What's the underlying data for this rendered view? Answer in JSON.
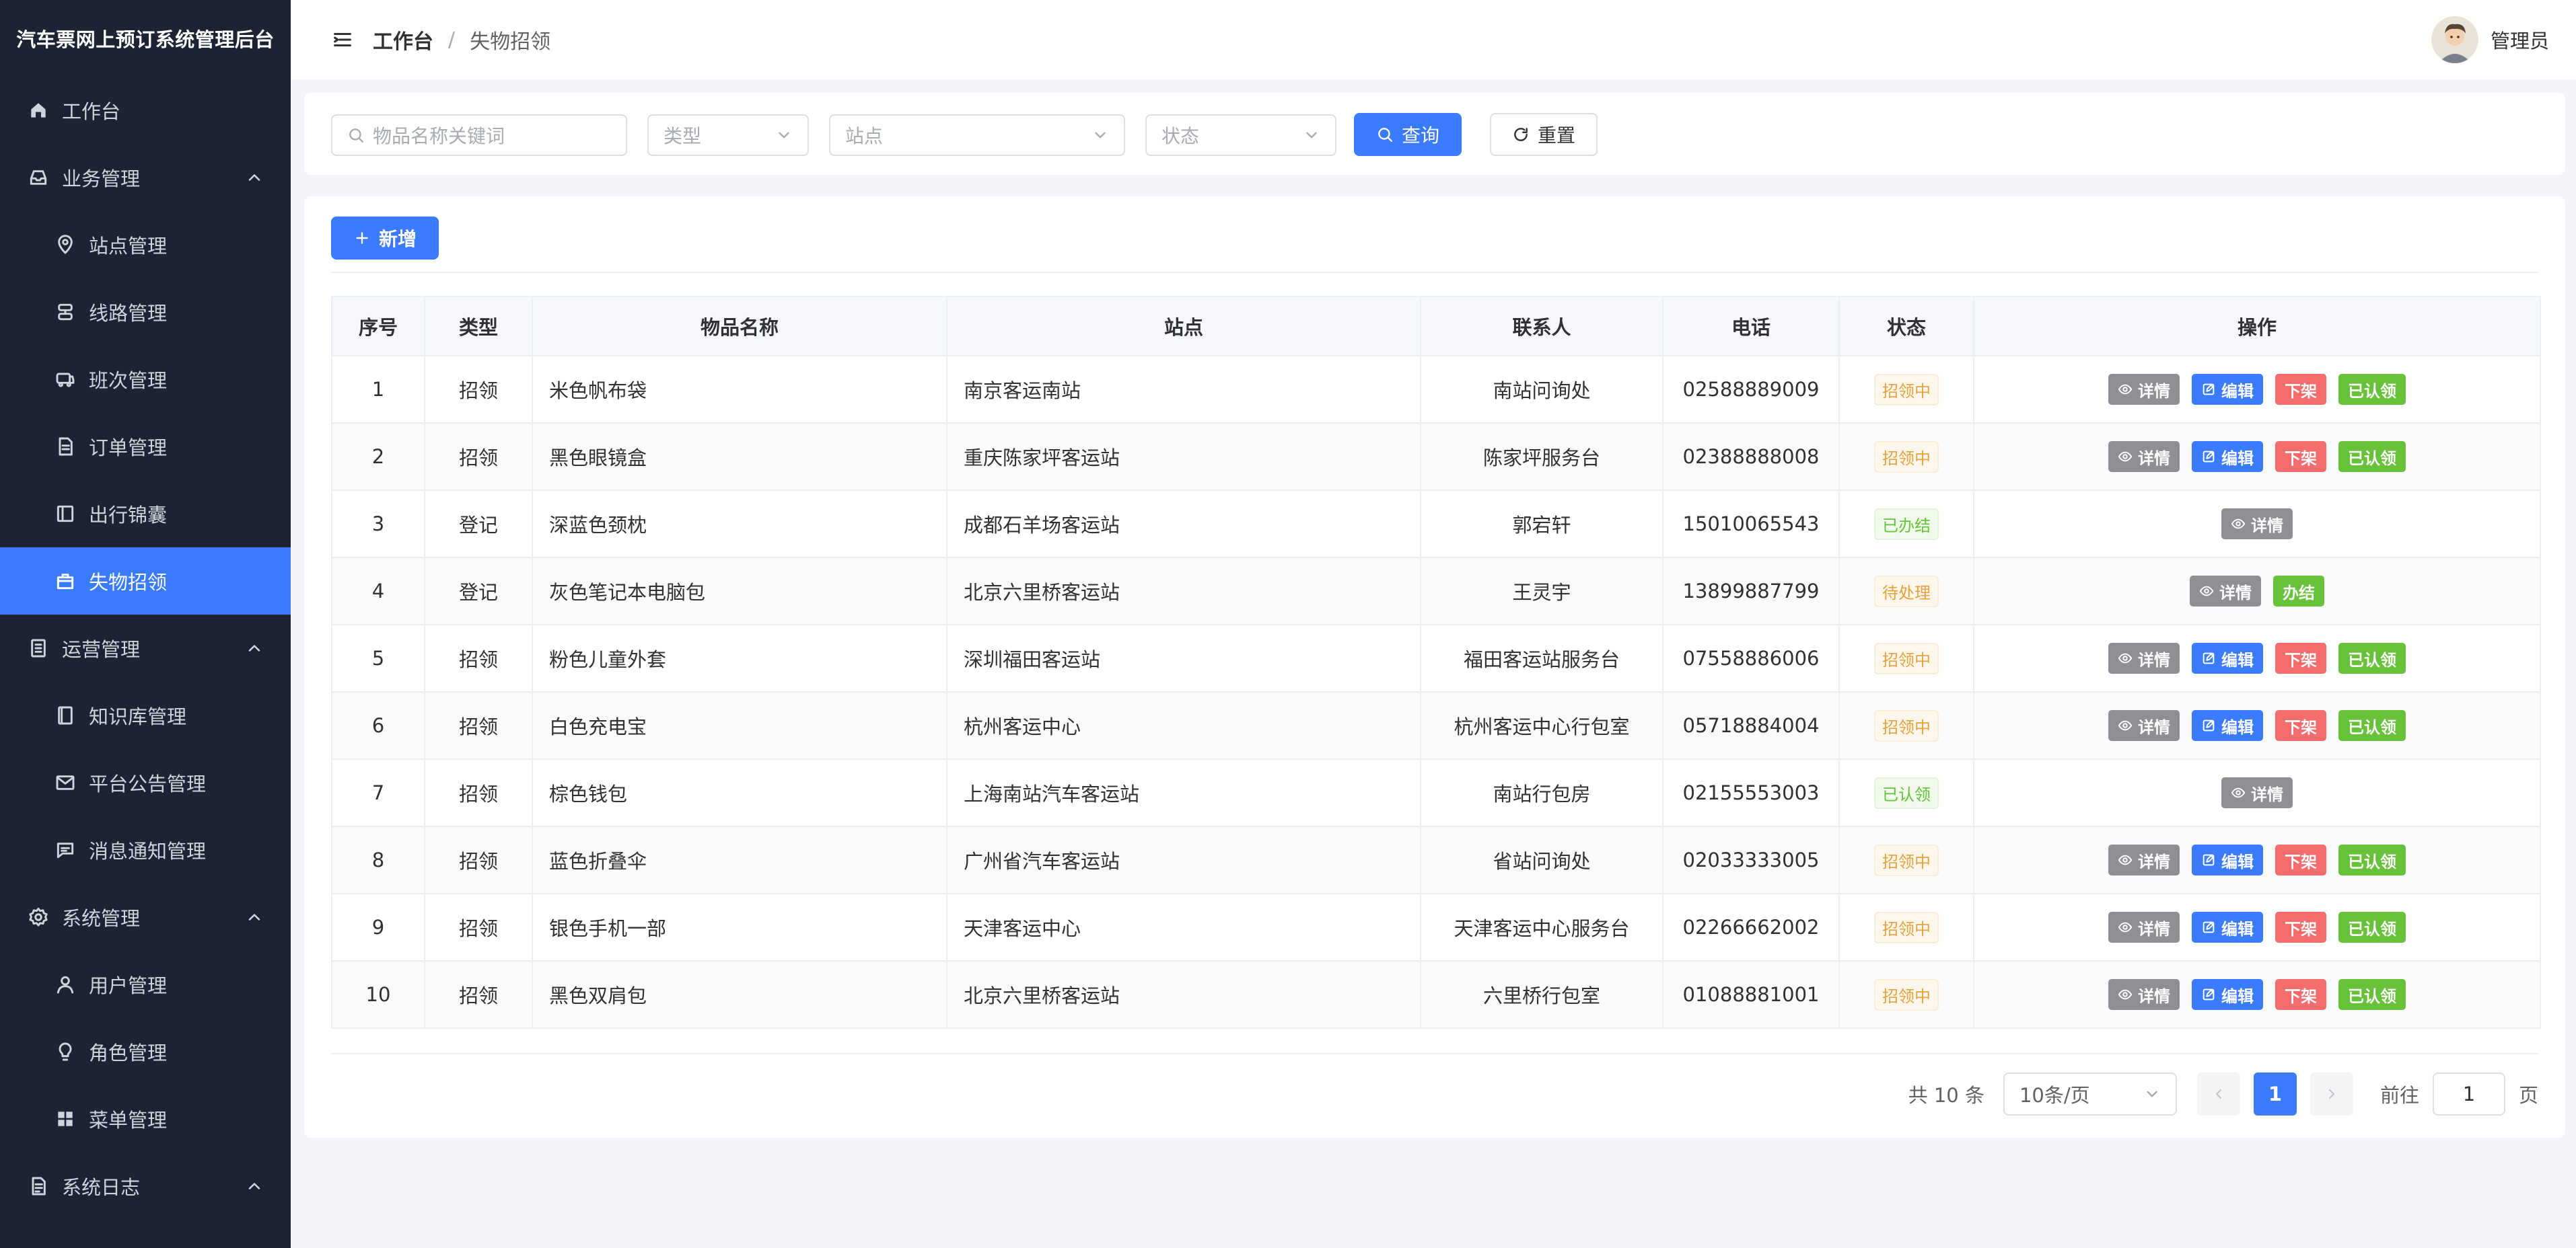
{
  "app": {
    "title": "汽车票网上预订系统管理后台"
  },
  "sidebar": {
    "items": [
      {
        "label": "工作台",
        "icon": "home-icon",
        "level": 0
      },
      {
        "label": "业务管理",
        "icon": "inbox-icon",
        "level": 0,
        "expanded": true
      },
      {
        "label": "站点管理",
        "icon": "location-icon",
        "level": 1
      },
      {
        "label": "线路管理",
        "icon": "route-icon",
        "level": 1
      },
      {
        "label": "班次管理",
        "icon": "bus-icon",
        "level": 1
      },
      {
        "label": "订单管理",
        "icon": "document-icon",
        "level": 1
      },
      {
        "label": "出行锦囊",
        "icon": "notebook-icon",
        "level": 1
      },
      {
        "label": "失物招领",
        "icon": "box-icon",
        "level": 1,
        "active": true
      },
      {
        "label": "运营管理",
        "icon": "tickets-icon",
        "level": 0,
        "expanded": true
      },
      {
        "label": "知识库管理",
        "icon": "book-icon",
        "level": 1
      },
      {
        "label": "平台公告管理",
        "icon": "message-icon",
        "level": 1
      },
      {
        "label": "消息通知管理",
        "icon": "chat-icon",
        "level": 1
      },
      {
        "label": "系统管理",
        "icon": "setting-icon",
        "level": 0,
        "expanded": true
      },
      {
        "label": "用户管理",
        "icon": "user-icon",
        "level": 1
      },
      {
        "label": "角色管理",
        "icon": "bulb-icon",
        "level": 1
      },
      {
        "label": "菜单管理",
        "icon": "grid-icon",
        "level": 1
      },
      {
        "label": "系统日志",
        "icon": "log-icon",
        "level": 0,
        "expanded": true
      }
    ]
  },
  "header": {
    "breadcrumb": [
      "工作台",
      "失物招领"
    ],
    "separator": "/",
    "user": "管理员"
  },
  "search": {
    "keyword_placeholder": "物品名称关键词",
    "type_placeholder": "类型",
    "station_placeholder": "站点",
    "status_placeholder": "状态",
    "query_label": "查询",
    "reset_label": "重置"
  },
  "toolbar": {
    "add_label": "新增"
  },
  "table": {
    "columns": [
      "序号",
      "类型",
      "物品名称",
      "站点",
      "联系人",
      "电话",
      "状态",
      "操作"
    ],
    "rows": [
      {
        "no": "1",
        "type": "招领",
        "name": "米色帆布袋",
        "station": "南京客运南站",
        "contact": "南站问询处",
        "phone": "02588889009",
        "status": "招领中",
        "status_color": "orange",
        "actions": [
          "详情",
          "编辑",
          "下架",
          "已认领"
        ]
      },
      {
        "no": "2",
        "type": "招领",
        "name": "黑色眼镜盒",
        "station": "重庆陈家坪客运站",
        "contact": "陈家坪服务台",
        "phone": "02388888008",
        "status": "招领中",
        "status_color": "orange",
        "actions": [
          "详情",
          "编辑",
          "下架",
          "已认领"
        ]
      },
      {
        "no": "3",
        "type": "登记",
        "name": "深蓝色颈枕",
        "station": "成都石羊场客运站",
        "contact": "郭宕轩",
        "phone": "15010065543",
        "status": "已办结",
        "status_color": "green",
        "actions": [
          "详情"
        ]
      },
      {
        "no": "4",
        "type": "登记",
        "name": "灰色笔记本电脑包",
        "station": "北京六里桥客运站",
        "contact": "王灵宇",
        "phone": "13899887799",
        "status": "待处理",
        "status_color": "orange",
        "actions": [
          "详情",
          "办结"
        ]
      },
      {
        "no": "5",
        "type": "招领",
        "name": "粉色儿童外套",
        "station": "深圳福田客运站",
        "contact": "福田客运站服务台",
        "phone": "07558886006",
        "status": "招领中",
        "status_color": "orange",
        "actions": [
          "详情",
          "编辑",
          "下架",
          "已认领"
        ]
      },
      {
        "no": "6",
        "type": "招领",
        "name": "白色充电宝",
        "station": "杭州客运中心",
        "contact": "杭州客运中心行包室",
        "phone": "05718884004",
        "status": "招领中",
        "status_color": "orange",
        "actions": [
          "详情",
          "编辑",
          "下架",
          "已认领"
        ]
      },
      {
        "no": "7",
        "type": "招领",
        "name": "棕色钱包",
        "station": "上海南站汽车客运站",
        "contact": "南站行包房",
        "phone": "02155553003",
        "status": "已认领",
        "status_color": "green",
        "actions": [
          "详情"
        ]
      },
      {
        "no": "8",
        "type": "招领",
        "name": "蓝色折叠伞",
        "station": "广州省汽车客运站",
        "contact": "省站问询处",
        "phone": "02033333005",
        "status": "招领中",
        "status_color": "orange",
        "actions": [
          "详情",
          "编辑",
          "下架",
          "已认领"
        ]
      },
      {
        "no": "9",
        "type": "招领",
        "name": "银色手机一部",
        "station": "天津客运中心",
        "contact": "天津客运中心服务台",
        "phone": "02266662002",
        "status": "招领中",
        "status_color": "orange",
        "actions": [
          "详情",
          "编辑",
          "下架",
          "已认领"
        ]
      },
      {
        "no": "10",
        "type": "招领",
        "name": "黑色双肩包",
        "station": "北京六里桥客运站",
        "contact": "六里桥行包室",
        "phone": "01088881001",
        "status": "招领中",
        "status_color": "orange",
        "actions": [
          "详情",
          "编辑",
          "下架",
          "已认领"
        ]
      }
    ]
  },
  "pagination": {
    "total_text": "共 10 条",
    "page_size": "10条/页",
    "current_page": "1",
    "goto_label": "前往",
    "goto_value": "1",
    "page_suffix": "页"
  },
  "colors": {
    "sidebar_bg": "#1e2333",
    "accent": "#3a7bfd",
    "danger": "#f56c6c",
    "success": "#67c23a",
    "info": "#8d8f94",
    "warning": "#e6a23c"
  }
}
